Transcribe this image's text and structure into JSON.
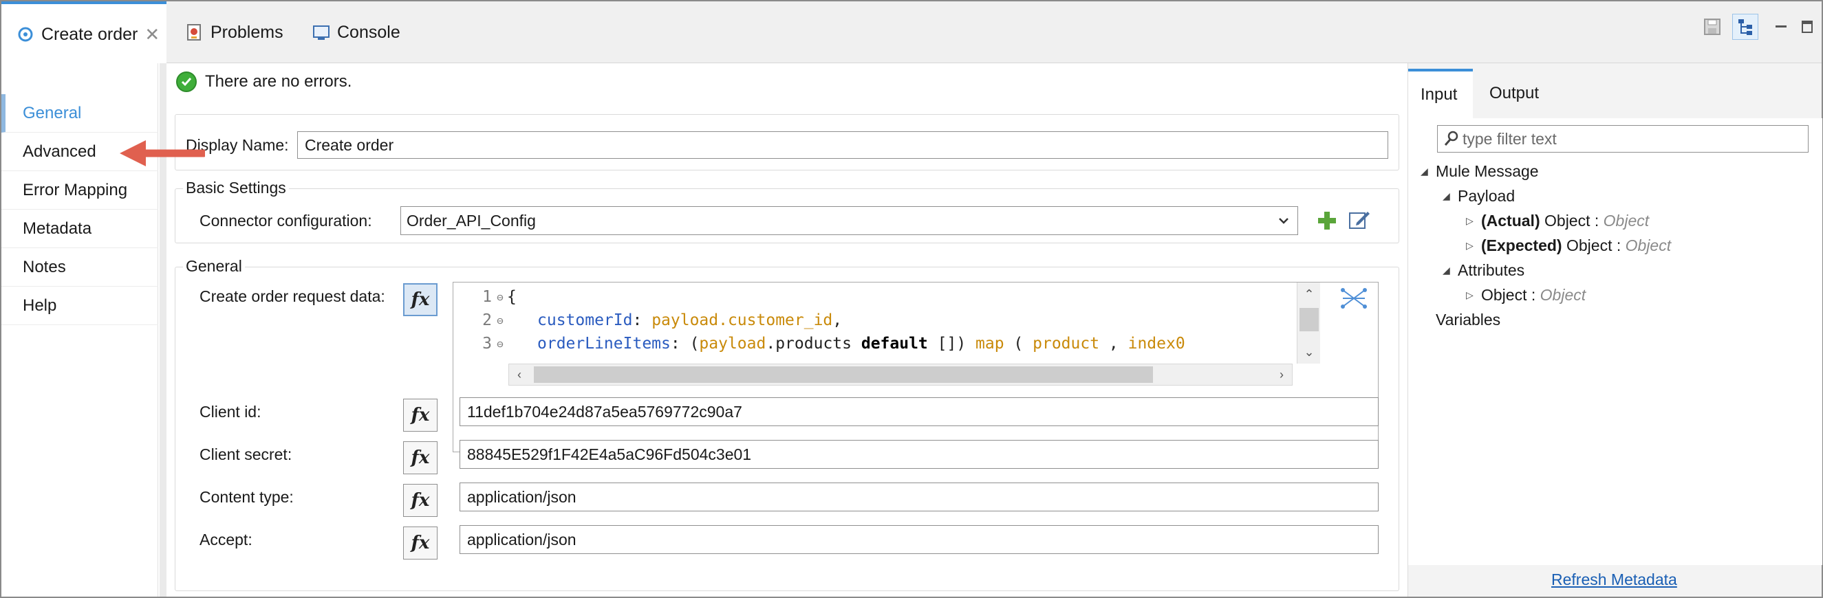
{
  "tabs": [
    {
      "label": "Create order",
      "icon": "connector-icon",
      "active": true
    },
    {
      "label": "Problems",
      "icon": "problems-icon",
      "active": false
    },
    {
      "label": "Console",
      "icon": "console-icon",
      "active": false
    }
  ],
  "left_nav": {
    "items": [
      {
        "label": "General",
        "active": true
      },
      {
        "label": "Advanced",
        "active": false
      },
      {
        "label": "Error Mapping",
        "active": false
      },
      {
        "label": "Metadata",
        "active": false
      },
      {
        "label": "Notes",
        "active": false
      },
      {
        "label": "Help",
        "active": false
      }
    ]
  },
  "status": {
    "message": "There are no errors."
  },
  "display_name": {
    "label": "Display Name:",
    "value": "Create order"
  },
  "basic_settings": {
    "title": "Basic Settings",
    "connector_label": "Connector configuration:",
    "connector_value": "Order_API_Config"
  },
  "general": {
    "title": "General",
    "request_label": "Create order request data:",
    "code": [
      {
        "num": "1",
        "text_plain": "{"
      },
      {
        "num": "2",
        "key": "customerId",
        "sep": ": ",
        "payload": "payload.customer_id",
        "tail": ","
      },
      {
        "num": "3",
        "key": "orderLineItems",
        "sep": ": (",
        "payload": "payload",
        "mid": ".products ",
        "kw": "default",
        "mid2": " []) ",
        "payload2": "map",
        "mid3": " ( ",
        "payload3": "product",
        "mid4": " , ",
        "payload4": "index0"
      }
    ],
    "fields": [
      {
        "label": "Client id:",
        "value": "11def1b704e24d87a5ea5769772c90a7"
      },
      {
        "label": "Client secret:",
        "value": "88845E529f1F42E4a5aC96Fd504c3e01"
      },
      {
        "label": "Content type:",
        "value": "application/json"
      },
      {
        "label": "Accept:",
        "value": "application/json"
      }
    ],
    "fx_label": "fx"
  },
  "right_panel": {
    "tabs": [
      {
        "label": "Input",
        "active": true
      },
      {
        "label": "Output",
        "active": false
      }
    ],
    "filter_placeholder": "type filter text",
    "tree": {
      "mule_message": "Mule Message",
      "payload": "Payload",
      "actual_bold": "(Actual)",
      "actual_rest": " Object : ",
      "actual_type": "Object",
      "expected_bold": "(Expected)",
      "expected_rest": " Object : ",
      "expected_type": "Object",
      "attributes": "Attributes",
      "attr_obj": "Object : ",
      "attr_type": "Object",
      "variables": "Variables"
    },
    "refresh_link": "Refresh Metadata"
  },
  "colors": {
    "accent": "#3c8fd8",
    "annotation_arrow": "#e0604f",
    "ok_green": "#3fae3a"
  }
}
